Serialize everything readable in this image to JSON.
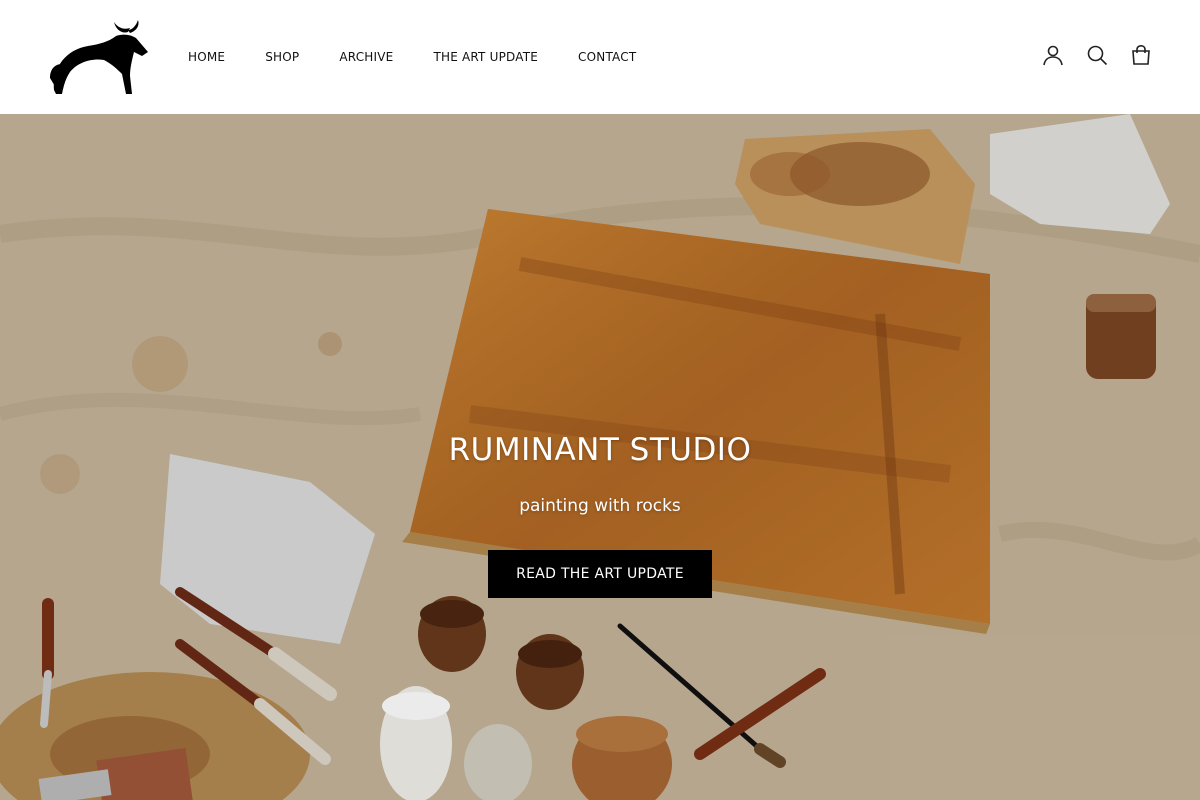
{
  "brand": {
    "logo_icon": "ox-logo-icon"
  },
  "nav": {
    "items": [
      {
        "label": "HOME"
      },
      {
        "label": "SHOP"
      },
      {
        "label": "ARCHIVE"
      },
      {
        "label": "THE ART UPDATE"
      },
      {
        "label": "CONTACT"
      }
    ]
  },
  "header_icons": {
    "account": "account-icon",
    "search": "search-icon",
    "cart": "cart-bag-icon"
  },
  "hero": {
    "title": "RUMINANT STUDIO",
    "subtitle": "painting with rocks",
    "button_label": "READ THE ART UPDATE"
  }
}
